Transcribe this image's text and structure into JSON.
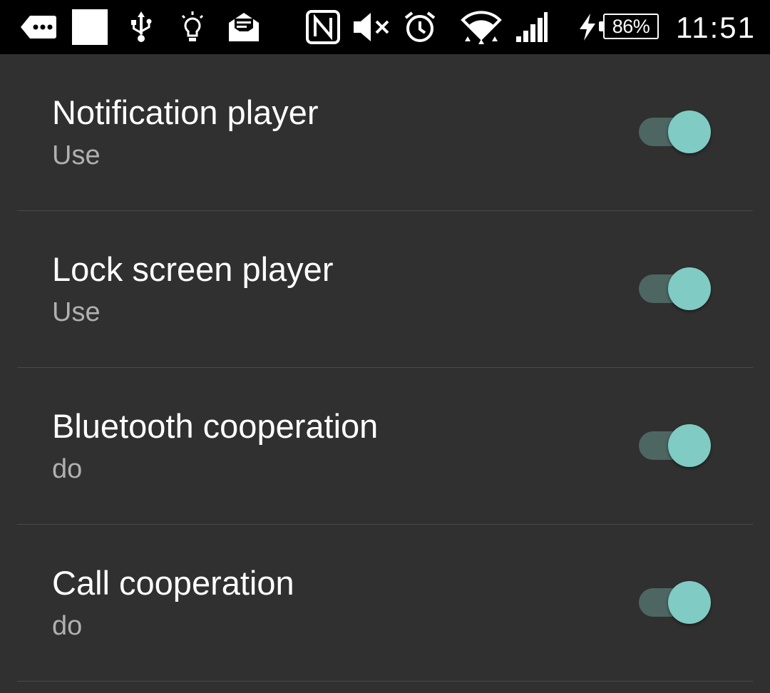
{
  "status_bar": {
    "icons": [
      "more-messages-icon",
      "blank-notification-icon",
      "usb-icon",
      "lightbulb-icon",
      "email-icon",
      "nfc-icon",
      "volume-muted-icon",
      "alarm-icon",
      "wifi-icon",
      "signal-icon",
      "charging-bolt-icon"
    ],
    "battery_percent": "86%",
    "battery_level": 0.86,
    "time": "11:51"
  },
  "settings": [
    {
      "title": "Notification player",
      "summary": "Use",
      "enabled": true
    },
    {
      "title": "Lock screen player",
      "summary": "Use",
      "enabled": true
    },
    {
      "title": "Bluetooth cooperation",
      "summary": "do",
      "enabled": true
    },
    {
      "title": "Call cooperation",
      "summary": "do",
      "enabled": true
    }
  ],
  "colors": {
    "background": "#303030",
    "status_bar": "#000000",
    "switch_thumb_on": "#80cbc4",
    "switch_track_on": "#4d6662",
    "divider": "#4a4a4a",
    "summary_text": "#b0b0b0"
  }
}
